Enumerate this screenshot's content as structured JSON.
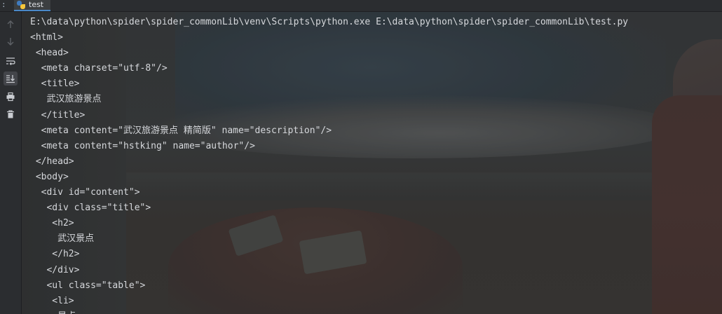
{
  "tab": {
    "overflow_label": ":",
    "title": "test"
  },
  "toolbar": {
    "items": [
      {
        "name": "up-arrow-icon"
      },
      {
        "name": "down-arrow-icon"
      },
      {
        "name": "soft-wrap-icon"
      },
      {
        "name": "scroll-to-end-icon"
      },
      {
        "name": "print-icon"
      },
      {
        "name": "trash-icon"
      }
    ]
  },
  "console": {
    "lines": [
      "E:\\data\\python\\spider\\spider_commonLib\\venv\\Scripts\\python.exe E:\\data\\python\\spider\\spider_commonLib\\test.py",
      "<html>",
      " <head>",
      "  <meta charset=\"utf-8\"/>",
      "  <title>",
      "   武汉旅游景点",
      "  </title>",
      "  <meta content=\"武汉旅游景点 精简版\" name=\"description\"/>",
      "  <meta content=\"hstking\" name=\"author\"/>",
      " </head>",
      " <body>",
      "  <div id=\"content\">",
      "   <div class=\"title\">",
      "    <h2>",
      "     武汉景点",
      "    </h2>",
      "   </div>",
      "   <ul class=\"table\">",
      "    <li>",
      "     景点"
    ]
  },
  "colors": {
    "text": "#d6d8dc",
    "background": "#2b2d30",
    "tab_underline": "#4a88c7"
  }
}
